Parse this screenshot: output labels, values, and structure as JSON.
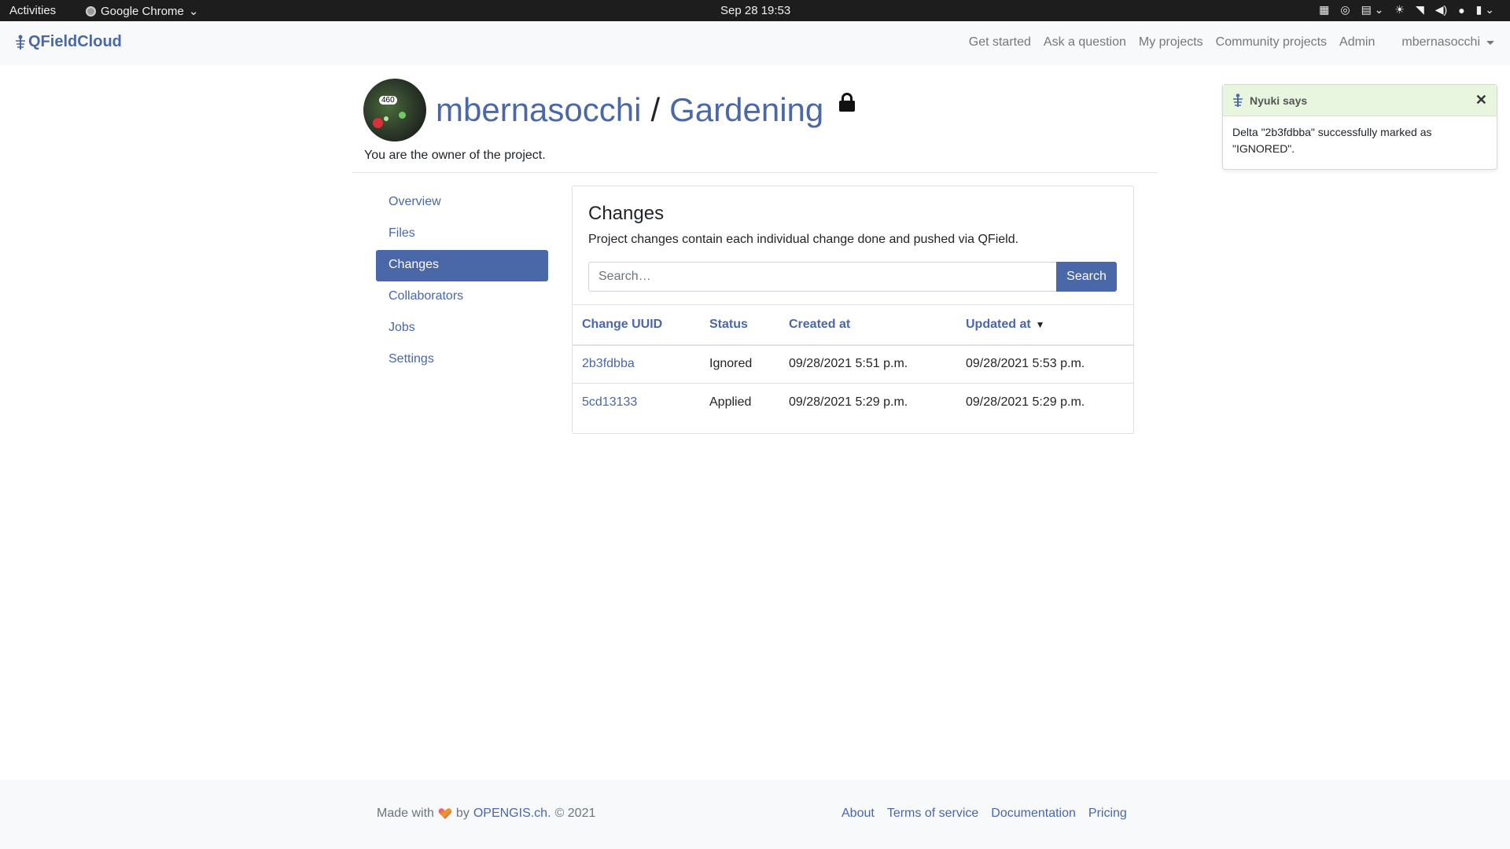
{
  "system_bar": {
    "activities": "Activities",
    "app_name": "Google Chrome",
    "clock": "Sep 28  19:53"
  },
  "navbar": {
    "brand": "QFieldCloud",
    "links": [
      "Get started",
      "Ask a question",
      "My projects",
      "Community projects",
      "Admin"
    ],
    "user": "mbernasocchi"
  },
  "project": {
    "owner": "mbernasocchi",
    "separator": "/",
    "name": "Gardening",
    "avatar_badge": "460",
    "owner_note": "You are the owner of the project."
  },
  "sidenav": {
    "items": [
      "Overview",
      "Files",
      "Changes",
      "Collaborators",
      "Jobs",
      "Settings"
    ],
    "active": "Changes"
  },
  "changes": {
    "title": "Changes",
    "description": "Project changes contain each individual change done and pushed via QField.",
    "search_placeholder": "Search…",
    "search_button": "Search",
    "columns": [
      "Change UUID",
      "Status",
      "Created at",
      "Updated at"
    ],
    "sort_indicator": "▼",
    "rows": [
      {
        "uuid": "2b3fdbba",
        "status": "Ignored",
        "created": "09/28/2021 5:51 p.m.",
        "updated": "09/28/2021 5:53 p.m."
      },
      {
        "uuid": "5cd13133",
        "status": "Applied",
        "created": "09/28/2021 5:29 p.m.",
        "updated": "09/28/2021 5:29 p.m."
      }
    ]
  },
  "toast": {
    "title": "Nyuki says",
    "close": "✕",
    "message": "Delta \"2b3fdbba\" successfully marked as \"IGNORED\"."
  },
  "footer": {
    "made_with": "Made with",
    "by": "by",
    "company": "OPENGIS.ch.",
    "copyright": "© 2021",
    "links": [
      "About",
      "Terms of service",
      "Documentation",
      "Pricing"
    ]
  },
  "colors": {
    "accent": "#4a67a8",
    "toast_header": "#e9f6df"
  }
}
